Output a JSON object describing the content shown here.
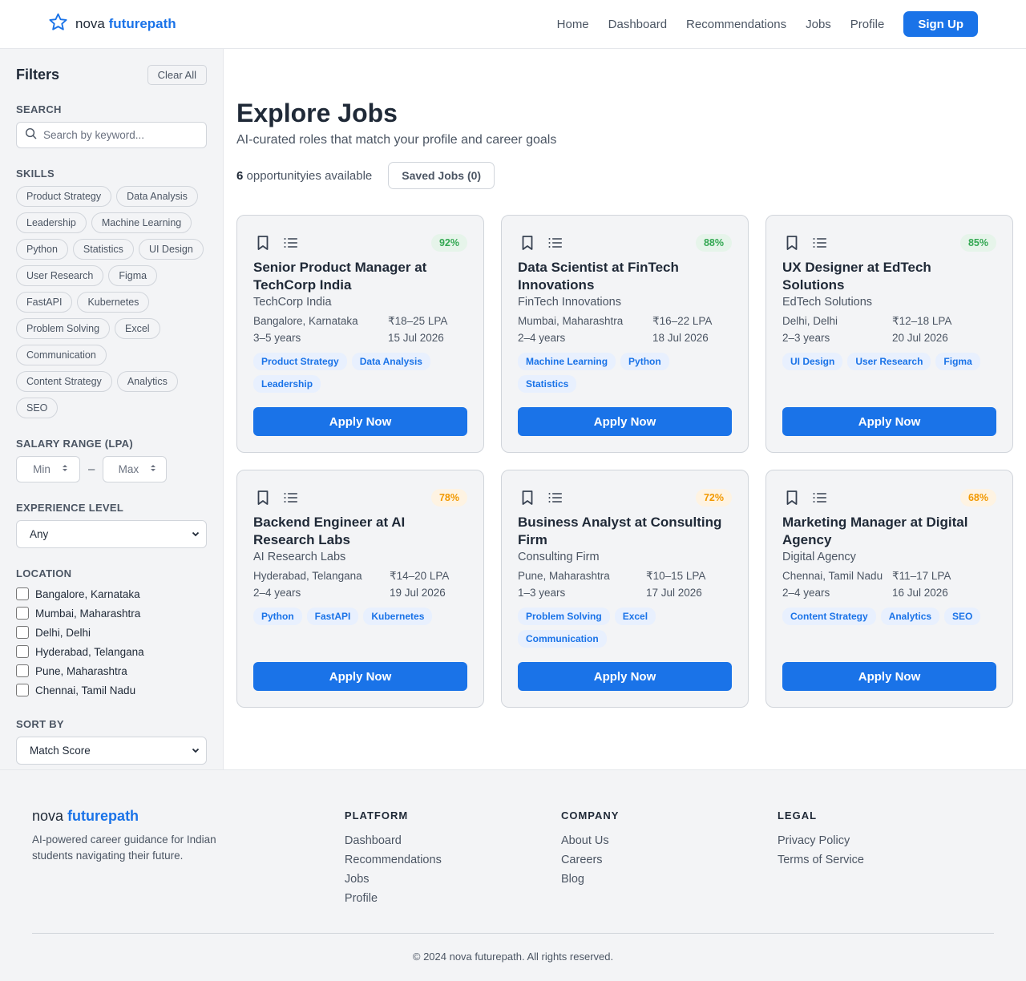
{
  "brand": {
    "part1": "nova",
    "part2": "futurepath"
  },
  "nav": {
    "home": "Home",
    "dashboard": "Dashboard",
    "recommendations": "Recommendations",
    "jobs": "Jobs",
    "profile": "Profile",
    "signup": "Sign Up"
  },
  "filters": {
    "title": "Filters",
    "clear": "Clear All",
    "search_label": "SEARCH",
    "search_placeholder": "Search by keyword...",
    "skills_label": "SKILLS",
    "skills": [
      "Product Strategy",
      "Data Analysis",
      "Leadership",
      "Machine Learning",
      "Python",
      "Statistics",
      "UI Design",
      "User Research",
      "Figma",
      "FastAPI",
      "Kubernetes",
      "Problem Solving",
      "Excel",
      "Communication",
      "Content Strategy",
      "Analytics",
      "SEO"
    ],
    "salary_label": "SALARY RANGE (LPA)",
    "salary_min": "Min",
    "salary_max": "Max",
    "salary_dash": "–",
    "experience_label": "EXPERIENCE LEVEL",
    "experience_value": "Any",
    "location_label": "LOCATION",
    "locations": [
      "Bangalore, Karnataka",
      "Mumbai, Maharashtra",
      "Delhi, Delhi",
      "Hyderabad, Telangana",
      "Pune, Maharashtra",
      "Chennai, Tamil Nadu"
    ],
    "sort_label": "SORT BY",
    "sort_value": "Match Score"
  },
  "main": {
    "title": "Explore Jobs",
    "subtitle": "AI-curated roles that match your profile and career goals",
    "count": "6",
    "count_text": " opportunityies available",
    "saved": "Saved Jobs (0)"
  },
  "jobs": [
    {
      "score": "92%",
      "score_color": "#34a853",
      "title": "Senior Product Manager at TechCorp India",
      "company": "TechCorp India",
      "location": "Bangalore, Karnataka",
      "salary": "₹18–25 LPA",
      "experience": "3–5 years",
      "date": "15 Jul 2026",
      "tags": [
        "Product Strategy",
        "Data Analysis",
        "Leadership"
      ],
      "apply": "Apply Now"
    },
    {
      "score": "88%",
      "score_color": "#34a853",
      "title": "Data Scientist at FinTech Innovations",
      "company": "FinTech Innovations",
      "location": "Mumbai, Maharashtra",
      "salary": "₹16–22 LPA",
      "experience": "2–4 years",
      "date": "18 Jul 2026",
      "tags": [
        "Machine Learning",
        "Python",
        "Statistics"
      ],
      "apply": "Apply Now"
    },
    {
      "score": "85%",
      "score_color": "#34a853",
      "title": "UX Designer at EdTech Solutions",
      "company": "EdTech Solutions",
      "location": "Delhi, Delhi",
      "salary": "₹12–18 LPA",
      "experience": "2–3 years",
      "date": "20 Jul 2026",
      "tags": [
        "UI Design",
        "User Research",
        "Figma"
      ],
      "apply": "Apply Now"
    },
    {
      "score": "78%",
      "score_color": "#f29900",
      "title": "Backend Engineer at AI Research Labs",
      "company": "AI Research Labs",
      "location": "Hyderabad, Telangana",
      "salary": "₹14–20 LPA",
      "experience": "2–4 years",
      "date": "19 Jul 2026",
      "tags": [
        "Python",
        "FastAPI",
        "Kubernetes"
      ],
      "apply": "Apply Now"
    },
    {
      "score": "72%",
      "score_color": "#f29900",
      "title": "Business Analyst at Consulting Firm",
      "company": "Consulting Firm",
      "location": "Pune, Maharashtra",
      "salary": "₹10–15 LPA",
      "experience": "1–3 years",
      "date": "17 Jul 2026",
      "tags": [
        "Problem Solving",
        "Excel",
        "Communication"
      ],
      "apply": "Apply Now"
    },
    {
      "score": "68%",
      "score_color": "#f29900",
      "title": "Marketing Manager at Digital Agency",
      "company": "Digital Agency",
      "location": "Chennai, Tamil Nadu",
      "salary": "₹11–17 LPA",
      "experience": "2–4 years",
      "date": "16 Jul 2026",
      "tags": [
        "Content Strategy",
        "Analytics",
        "SEO"
      ],
      "apply": "Apply Now"
    }
  ],
  "footer": {
    "brand1": "nova",
    "brand2": "futurepath",
    "desc": "AI-powered career guidance for Indian students navigating their future.",
    "platform": {
      "heading": "PLATFORM",
      "links": [
        "Dashboard",
        "Recommendations",
        "Jobs",
        "Profile"
      ]
    },
    "company": {
      "heading": "COMPANY",
      "links": [
        "About Us",
        "Careers",
        "Blog"
      ]
    },
    "legal": {
      "heading": "LEGAL",
      "links": [
        "Privacy Policy",
        "Terms of Service"
      ]
    },
    "copyright": "© 2024 nova futurepath. All rights reserved."
  },
  "colors": {
    "accent": "#1a73e8",
    "score_high": "#34a853",
    "score_mid": "#f29900"
  },
  "icons": {
    "brand": "star-icon",
    "search": "search-icon",
    "bookmark": "bookmark-icon",
    "list": "list-icon",
    "spinner": "number-spinner-icon",
    "dropdown": "chevron-down-icon"
  }
}
